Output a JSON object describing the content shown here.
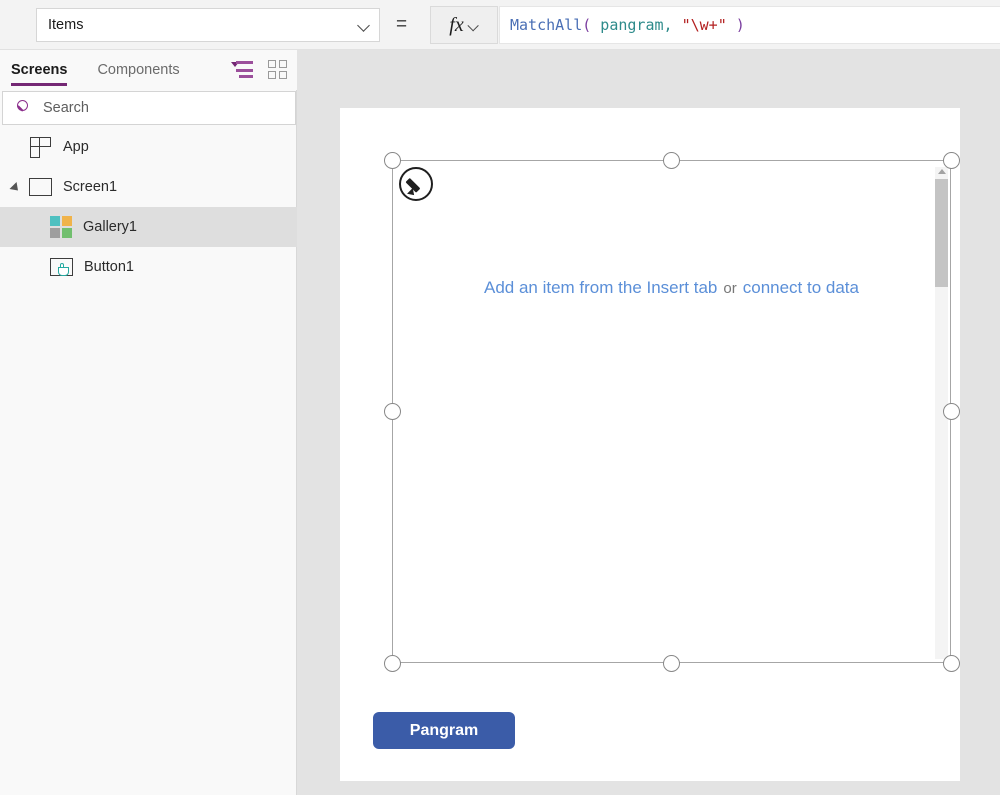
{
  "formula_bar": {
    "property_selected": "Items",
    "equals_sign": "=",
    "fx_label": "fx",
    "formula_tokens": [
      {
        "text": "MatchAll",
        "kind": "function"
      },
      {
        "text": "(",
        "kind": "paren"
      },
      {
        "text": " pangram",
        "kind": "identifier"
      },
      {
        "text": ",",
        "kind": "punct"
      },
      {
        "text": " ",
        "kind": "plain"
      },
      {
        "text": "\"\\w+\"",
        "kind": "string"
      },
      {
        "text": " ",
        "kind": "plain"
      },
      {
        "text": ")",
        "kind": "paren"
      }
    ],
    "formula_text": "MatchAll( pangram, \"\\w+\" )"
  },
  "left_panel": {
    "tabs": [
      {
        "label": "Screens",
        "active": true
      },
      {
        "label": "Components",
        "active": false
      }
    ],
    "view_icons": [
      {
        "name": "tree-view-icon",
        "active": true
      },
      {
        "name": "thumbnail-view-icon",
        "active": false
      }
    ],
    "search": {
      "placeholder": "Search",
      "value": "",
      "icon": "search-icon"
    },
    "tree": [
      {
        "label": "App",
        "icon": "app-icon",
        "indent": 0,
        "selected": false,
        "expandable": false
      },
      {
        "label": "Screen1",
        "icon": "screen-icon",
        "indent": 0,
        "selected": false,
        "expandable": true,
        "expanded": true
      },
      {
        "label": "Gallery1",
        "icon": "gallery-icon",
        "indent": 1,
        "selected": true,
        "expandable": false
      },
      {
        "label": "Button1",
        "icon": "button-icon",
        "indent": 1,
        "selected": false,
        "expandable": false
      }
    ]
  },
  "canvas": {
    "gallery": {
      "name": "Gallery1",
      "empty_prefix": "Add an item from the Insert tab",
      "empty_middle": "or",
      "empty_suffix": "connect to data",
      "edit_icon": "pencil-icon",
      "scrollbar": "vertical-scrollbar"
    },
    "button": {
      "label": "Pangram"
    }
  },
  "colors": {
    "accent_purple": "#742774",
    "link_blue": "#5b8fd8",
    "button_blue": "#3b5ca8",
    "canvas_bg": "#e3e3e3",
    "selection_gray": "#dedede"
  }
}
